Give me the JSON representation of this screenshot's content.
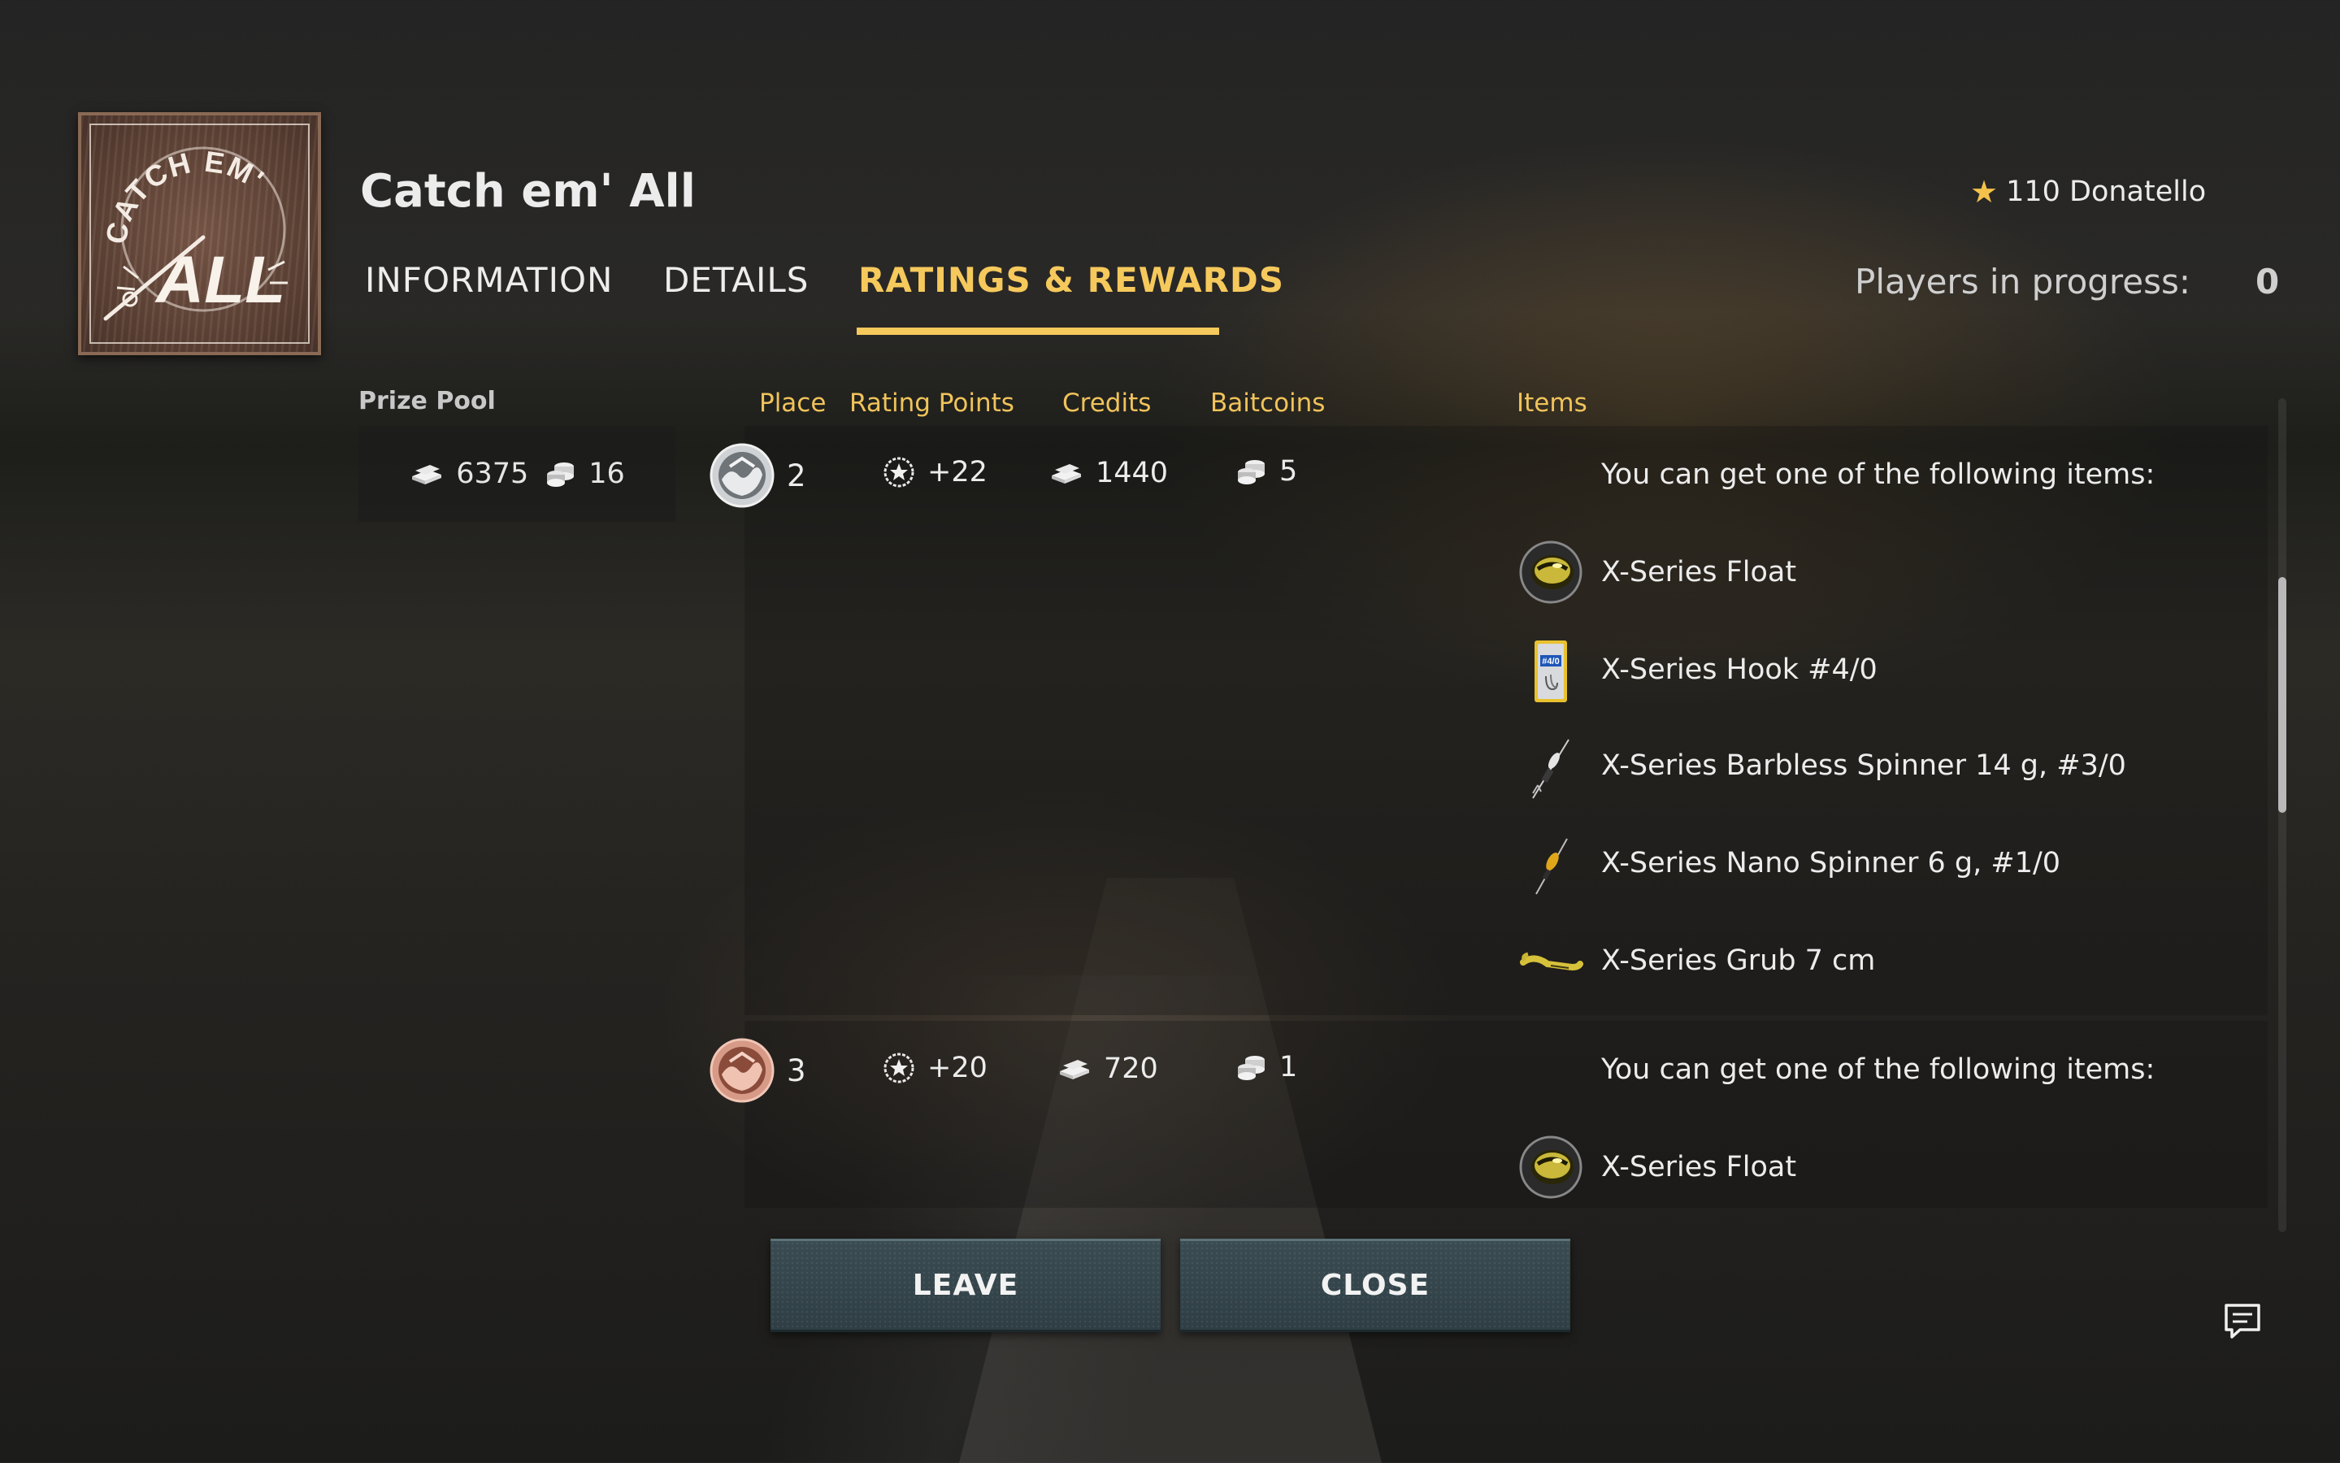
{
  "event": {
    "title": "Catch em' All",
    "logo_text_top": "CATCH EM'",
    "logo_text_bottom": "ALL"
  },
  "user": {
    "rank_value": "110",
    "name": "Donatello",
    "rank_display": "110 Donatello"
  },
  "tabs": [
    {
      "label": "INFORMATION",
      "active": false
    },
    {
      "label": "DETAILS",
      "active": false
    },
    {
      "label": "RATINGS & REWARDS",
      "active": true
    }
  ],
  "players_in_progress": {
    "label": "Players in progress:",
    "value": "0"
  },
  "columns": {
    "prize_pool": "Prize Pool",
    "place": "Place",
    "rating_points": "Rating Points",
    "credits": "Credits",
    "baitcoins": "Baitcoins",
    "items": "Items"
  },
  "prize_pool": {
    "credits": "6375",
    "baitcoins": "16"
  },
  "rewards": [
    {
      "place": "2",
      "medal": "silver-medal",
      "rating_points": "+22",
      "credits": "1440",
      "baitcoins": "5",
      "items_intro": "You can get one of the following items:",
      "items": [
        {
          "name": "X-Series Float",
          "icon": "float-icon"
        },
        {
          "name": "X-Series Hook #4/0",
          "icon": "hook-pack-icon"
        },
        {
          "name": "X-Series Barbless Spinner 14 g, #3/0",
          "icon": "spinner-icon"
        },
        {
          "name": "X-Series Nano Spinner 6 g, #1/0",
          "icon": "nano-spinner-icon"
        },
        {
          "name": "X-Series Grub 7 cm",
          "icon": "grub-icon"
        }
      ]
    },
    {
      "place": "3",
      "medal": "bronze-medal",
      "rating_points": "+20",
      "credits": "720",
      "baitcoins": "1",
      "items_intro": "You can get one of the following items:",
      "items": [
        {
          "name": "X-Series Float",
          "icon": "float-icon"
        }
      ]
    }
  ],
  "buttons": {
    "leave": "LEAVE",
    "close": "CLOSE"
  },
  "colors": {
    "accent": "#f6c95c",
    "button": "#34474d",
    "text": "#ececec"
  }
}
